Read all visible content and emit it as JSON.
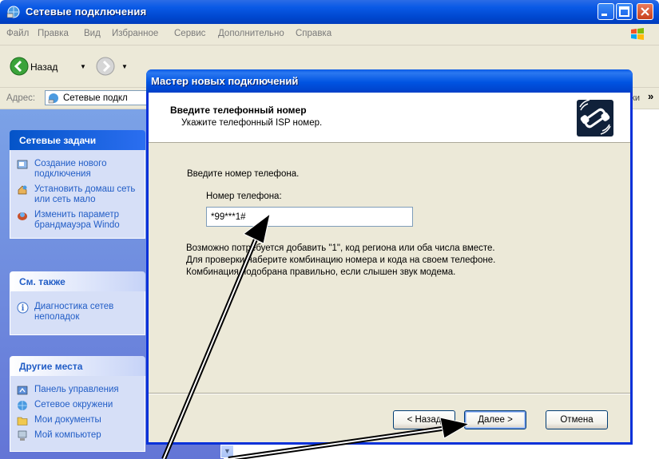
{
  "window": {
    "title": "Сетевые подключения"
  },
  "menu": [
    "Файл",
    "Правка",
    "Вид",
    "Избранное",
    "Сервис",
    "Дополнительно",
    "Справка"
  ],
  "toolbar": {
    "back_label": "Назад"
  },
  "address": {
    "label": "Адрес:",
    "value": "Сетевые подкл",
    "links_label": "ки"
  },
  "taskpane": {
    "network_tasks": {
      "title": "Сетевые задачи",
      "items": [
        {
          "label": "Создание нового подключения",
          "icon": "new-connection-icon"
        },
        {
          "label": "Установить домаш сеть или сеть мало",
          "icon": "home-network-icon"
        },
        {
          "label": "Изменить параметр брандмауэра Windo",
          "icon": "firewall-icon"
        }
      ]
    },
    "see_also": {
      "title": "См. также",
      "items": [
        {
          "label": "Диагностика сетев неполадок",
          "icon": "info-icon"
        }
      ]
    },
    "other_places": {
      "title": "Другие места",
      "items": [
        {
          "label": "Панель управления",
          "icon": "control-panel-icon"
        },
        {
          "label": "Сетевое окружени",
          "icon": "network-places-icon"
        },
        {
          "label": "Мои документы",
          "icon": "my-documents-icon"
        },
        {
          "label": "Мой компьютер",
          "icon": "my-computer-icon"
        }
      ]
    }
  },
  "dialog": {
    "title": "Мастер новых подключений",
    "header": {
      "title": "Введите телефонный номер",
      "subtitle": "Укажите телефонный  ISP номер."
    },
    "intro": "Введите номер телефона.",
    "phone_label": "Номер телефона:",
    "phone_value": "*99***1#",
    "hint": [
      "Возможно потребуется добавить \"1\", код региона или оба числа вместе.",
      "Для проверки наберите комбинацию номера и кода на своем телефоне.",
      "Комбинация подобрана правильно, если слышен звук модема."
    ],
    "buttons": {
      "back": "< Назад",
      "next": "Далее >",
      "cancel": "Отмена"
    }
  },
  "colors": {
    "xp_blue": "#0054e2",
    "taskpane_top": "#7ba2e7",
    "dialog_bg": "#ece9d8",
    "link": "#215dc6"
  }
}
